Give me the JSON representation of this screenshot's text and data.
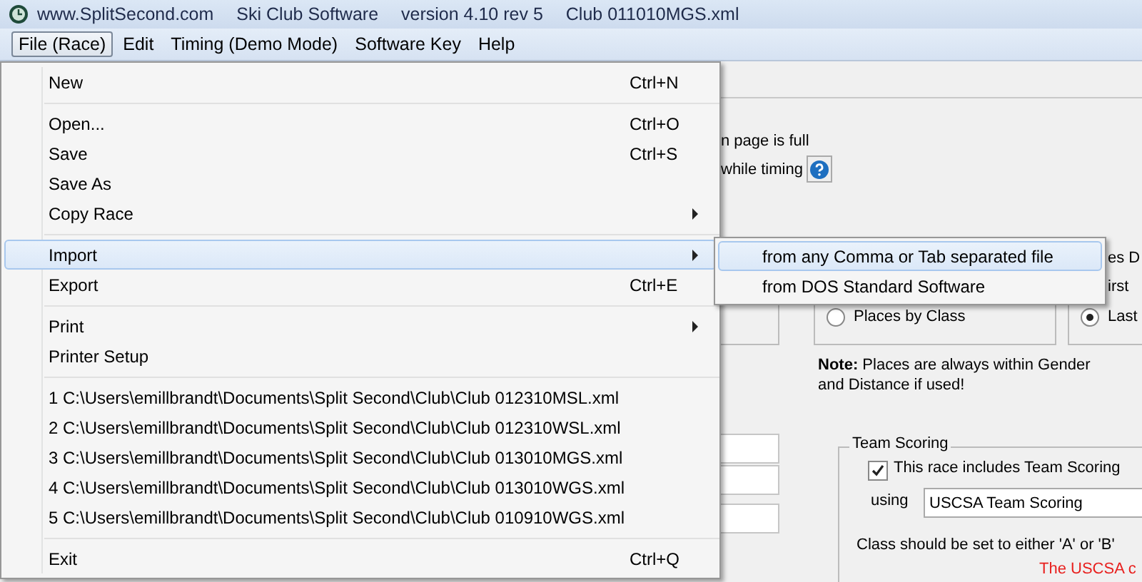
{
  "window": {
    "title_parts": [
      "www.SplitSecond.com",
      "Ski Club Software",
      "version 4.10 rev 5",
      "Club 011010MGS.xml"
    ]
  },
  "menu_bar": [
    {
      "label": "File (Race)",
      "selected": true
    },
    {
      "label": "Edit",
      "selected": false
    },
    {
      "label": "Timing (Demo Mode)",
      "selected": false
    },
    {
      "label": "Software Key",
      "selected": false
    },
    {
      "label": "Help",
      "selected": false
    }
  ],
  "file_menu": {
    "items": [
      {
        "kind": "item",
        "label": "New",
        "shortcut": "Ctrl+N",
        "submenu": false,
        "selected": false
      },
      {
        "kind": "separator"
      },
      {
        "kind": "item",
        "label": "Open...",
        "shortcut": "Ctrl+O",
        "submenu": false,
        "selected": false
      },
      {
        "kind": "item",
        "label": "Save",
        "shortcut": "Ctrl+S",
        "submenu": false,
        "selected": false
      },
      {
        "kind": "item",
        "label": "Save As",
        "submenu": false,
        "selected": false
      },
      {
        "kind": "item",
        "label": "Copy Race",
        "submenu": true,
        "selected": false
      },
      {
        "kind": "separator"
      },
      {
        "kind": "item",
        "label": "Import",
        "submenu": true,
        "selected": true
      },
      {
        "kind": "item",
        "label": "Export",
        "shortcut": "Ctrl+E",
        "submenu": false,
        "selected": false
      },
      {
        "kind": "separator"
      },
      {
        "kind": "item",
        "label": "Print",
        "submenu": true,
        "selected": false
      },
      {
        "kind": "item",
        "label": "Printer Setup",
        "submenu": false,
        "selected": false
      },
      {
        "kind": "separator"
      },
      {
        "kind": "item",
        "label": "1  C:\\Users\\emillbrandt\\Documents\\Split Second\\Club\\Club 012310MSL.xml",
        "submenu": false,
        "selected": false
      },
      {
        "kind": "item",
        "label": "2  C:\\Users\\emillbrandt\\Documents\\Split Second\\Club\\Club 012310WSL.xml",
        "submenu": false,
        "selected": false
      },
      {
        "kind": "item",
        "label": "3  C:\\Users\\emillbrandt\\Documents\\Split Second\\Club\\Club 013010MGS.xml",
        "submenu": false,
        "selected": false
      },
      {
        "kind": "item",
        "label": "4  C:\\Users\\emillbrandt\\Documents\\Split Second\\Club\\Club 013010WGS.xml",
        "submenu": false,
        "selected": false
      },
      {
        "kind": "item",
        "label": "5  C:\\Users\\emillbrandt\\Documents\\Split Second\\Club\\Club 010910WGS.xml",
        "submenu": false,
        "selected": false
      },
      {
        "kind": "separator"
      },
      {
        "kind": "item",
        "label": "Exit",
        "shortcut": "Ctrl+Q",
        "submenu": false,
        "selected": false
      }
    ]
  },
  "import_submenu": [
    {
      "label": "from any Comma or Tab separated file",
      "selected": true
    },
    {
      "label": "from DOS Standard Software",
      "selected": false
    }
  ],
  "form": {
    "page_full_text": "n page is full",
    "timing_text": "while timing",
    "right_text_1": "es D",
    "right_text_2": "irst",
    "place_options": [
      {
        "label": "Places by Class",
        "selected": false
      },
      {
        "label": "Last",
        "selected": true
      }
    ],
    "note": "**Note:**  Places are always within Gender and Distance if used!",
    "team_scoring": {
      "title": "Team Scoring",
      "include_label": "This race includes Team Scoring",
      "checked": true,
      "using_label": "using",
      "method": "USCSA Team Scoring",
      "hint": "Class should be set to either 'A' or 'B'",
      "warning": "The USCSA c"
    }
  }
}
